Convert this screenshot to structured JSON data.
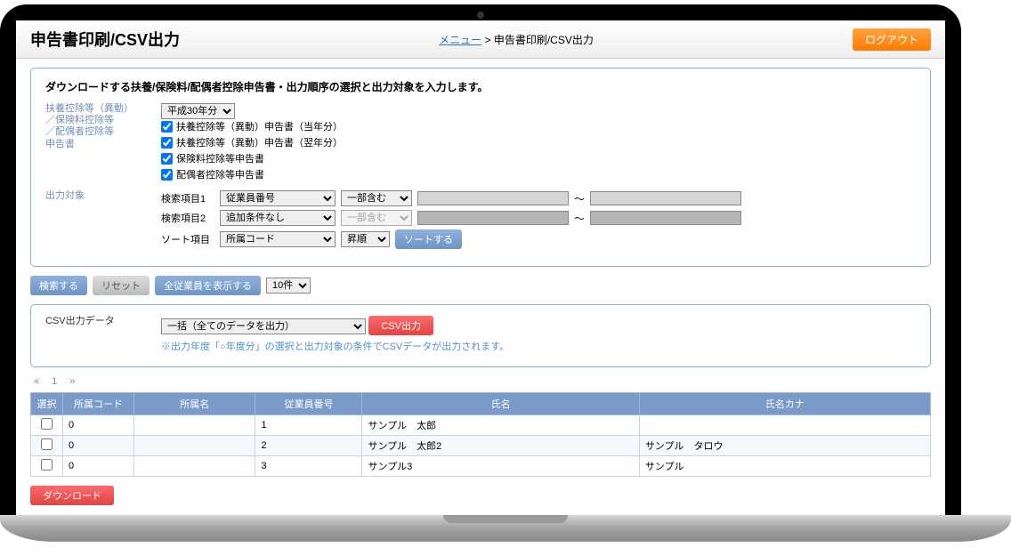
{
  "header": {
    "title": "申告書印刷/CSV出力",
    "menu_link": "メニュー",
    "sep": " > ",
    "page": "申告書印刷/CSV出力",
    "logout": "ログアウト"
  },
  "panel1": {
    "instr": "ダウンロードする扶養/保険料/配偶者控除申告書・出力順序の選択と出力対象を入力します。",
    "section1_label": "扶養控除等（異動）\n／保険料控除等\n／配偶者控除等\n申告書",
    "year": "平成30年分",
    "chk1": "扶養控除等（異動）申告書（当年分）",
    "chk2": "扶養控除等（異動）申告書（翌年分）",
    "chk3": "保険料控除等申告書",
    "chk4": "配偶者控除等申告書",
    "section2_label": "出力対象",
    "s1_lab": "検索項目1",
    "s1_field": "従業員番号",
    "s1_match": "一部含む",
    "s2_lab": "検索項目2",
    "s2_field": "追加条件なし",
    "s2_match": "一部含む",
    "sort_lab": "ソート項目",
    "sort_field": "所属コード",
    "sort_order": "昇順",
    "sort_btn": "ソートする",
    "tilde": "～"
  },
  "btnbar": {
    "search": "検索する",
    "reset": "リセット",
    "show_all": "全従業員を表示する",
    "per_page": "10件"
  },
  "panel2": {
    "label": "CSV出力データ",
    "option": "一括（全てのデータを出力）",
    "btn": "CSV出力",
    "note": "※出力年度「○年度分」の選択と出力対象の条件でCSVデータが出力されます。"
  },
  "pager": {
    "prev": "«",
    "page": "1",
    "next": "»"
  },
  "table": {
    "headers": [
      "選択",
      "所属コード",
      "所属名",
      "従業員番号",
      "氏名",
      "氏名カナ"
    ],
    "rows": [
      {
        "code": "0",
        "name": "",
        "emp": "1",
        "shimei": "サンプル　太郎",
        "kana": ""
      },
      {
        "code": "0",
        "name": "",
        "emp": "2",
        "shimei": "サンプル　太郎2",
        "kana": "サンプル　タロウ"
      },
      {
        "code": "0",
        "name": "",
        "emp": "3",
        "shimei": "サンプル3",
        "kana": "サンプル"
      }
    ]
  },
  "download_btn": "ダウンロード"
}
